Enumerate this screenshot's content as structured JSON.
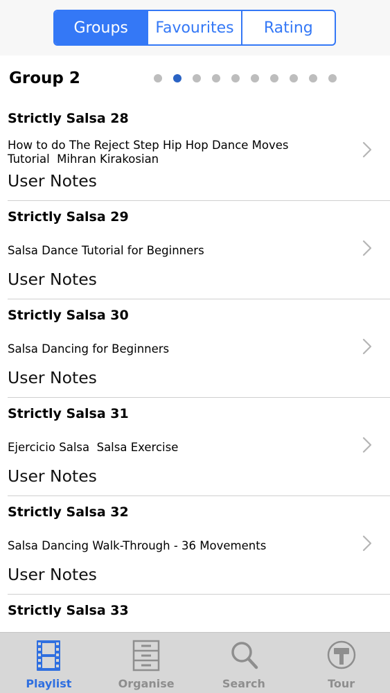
{
  "segments": {
    "items": [
      {
        "label": "Groups",
        "selected": true
      },
      {
        "label": "Favourites",
        "selected": false
      },
      {
        "label": "Rating",
        "selected": false
      }
    ]
  },
  "group": {
    "title": "Group 2",
    "page_count": 10,
    "current_page": 2
  },
  "list": {
    "items": [
      {
        "title": "Strictly Salsa 28",
        "subtitle": "How to do The Reject Step Hip Hop Dance Moves\nTutorial  Mihran Kirakosian",
        "notes": "User Notes"
      },
      {
        "title": "Strictly Salsa 29",
        "subtitle": "Salsa Dance Tutorial for Beginners",
        "notes": "User Notes"
      },
      {
        "title": "Strictly Salsa 30",
        "subtitle": "Salsa Dancing for Beginners",
        "notes": "User Notes"
      },
      {
        "title": "Strictly Salsa 31",
        "subtitle": "Ejercicio Salsa  Salsa Exercise",
        "notes": "User Notes"
      },
      {
        "title": "Strictly Salsa 32",
        "subtitle": "Salsa Dancing Walk-Through - 36 Movements",
        "notes": "User Notes"
      },
      {
        "title": "Strictly Salsa 33",
        "subtitle": "",
        "notes": ""
      }
    ]
  },
  "tab_bar": {
    "items": [
      {
        "label": "Playlist",
        "icon": "film-strip-icon",
        "selected": true
      },
      {
        "label": "Organise",
        "icon": "cabinet-icon",
        "selected": false
      },
      {
        "label": "Search",
        "icon": "magnifier-icon",
        "selected": false
      },
      {
        "label": "Tour",
        "icon": "tour-sign-icon",
        "selected": false
      }
    ]
  },
  "colors": {
    "accent": "#3478f6",
    "active_dot": "#2a63c4",
    "inactive_dot": "#bdbdbd",
    "tab_bar_bg": "#d7d7d7",
    "tab_inactive": "#8e8e8e"
  }
}
